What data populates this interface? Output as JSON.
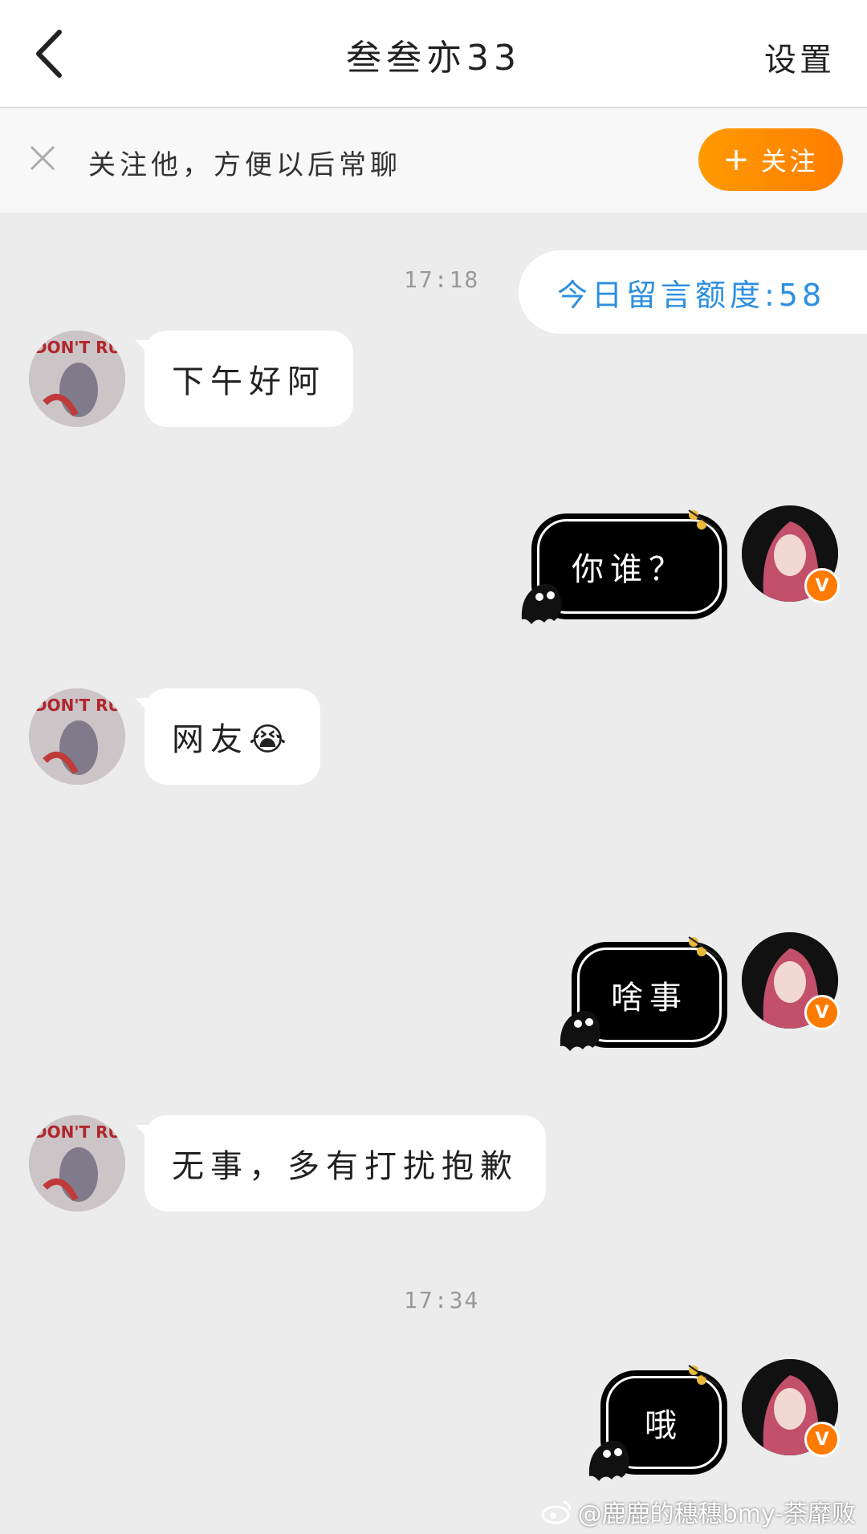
{
  "header": {
    "title": "叁叁亦33",
    "settings_label": "设置"
  },
  "follow_bar": {
    "text": "关注他，方便以后常聊",
    "button_label": "关注"
  },
  "timestamps": [
    "17:18",
    "17:34"
  ],
  "quota": {
    "text": "今日留言额度:58"
  },
  "messages": [
    {
      "side": "in",
      "text": "下午好阿"
    },
    {
      "side": "out",
      "text": "你谁？"
    },
    {
      "side": "in",
      "text": "网友😭"
    },
    {
      "side": "out",
      "text": "啥事"
    },
    {
      "side": "in",
      "text": "无事，多有打扰抱歉"
    },
    {
      "side": "out",
      "text": "哦"
    }
  ],
  "avatars": {
    "other_caption": "DON'T RUN",
    "self_badge": "V"
  },
  "watermark": {
    "text": "@鹿鹿的穗穗bmy-荼靡败"
  },
  "colors": {
    "accent_orange": "#ff8a00",
    "quota_blue": "#2d8fe0",
    "background": "#ececec"
  }
}
